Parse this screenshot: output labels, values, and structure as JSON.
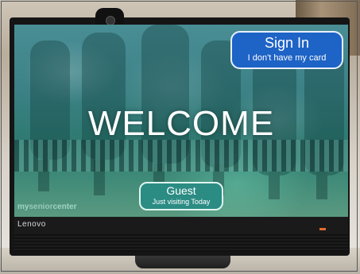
{
  "screen": {
    "welcome_text": "WELCOME",
    "sign_in": {
      "title": "Sign In",
      "subtitle": "I don't have my card"
    },
    "guest": {
      "title": "Guest",
      "subtitle": "Just visiting Today"
    },
    "logo": {
      "prefix": "my",
      "middle": "senior",
      "suffix": "center"
    },
    "colors": {
      "sign_in_bg": "#1e63c6",
      "guest_bg": "#2b8c84",
      "screen_tint": "#3b8185"
    }
  },
  "monitor": {
    "brand": "Lenovo"
  }
}
